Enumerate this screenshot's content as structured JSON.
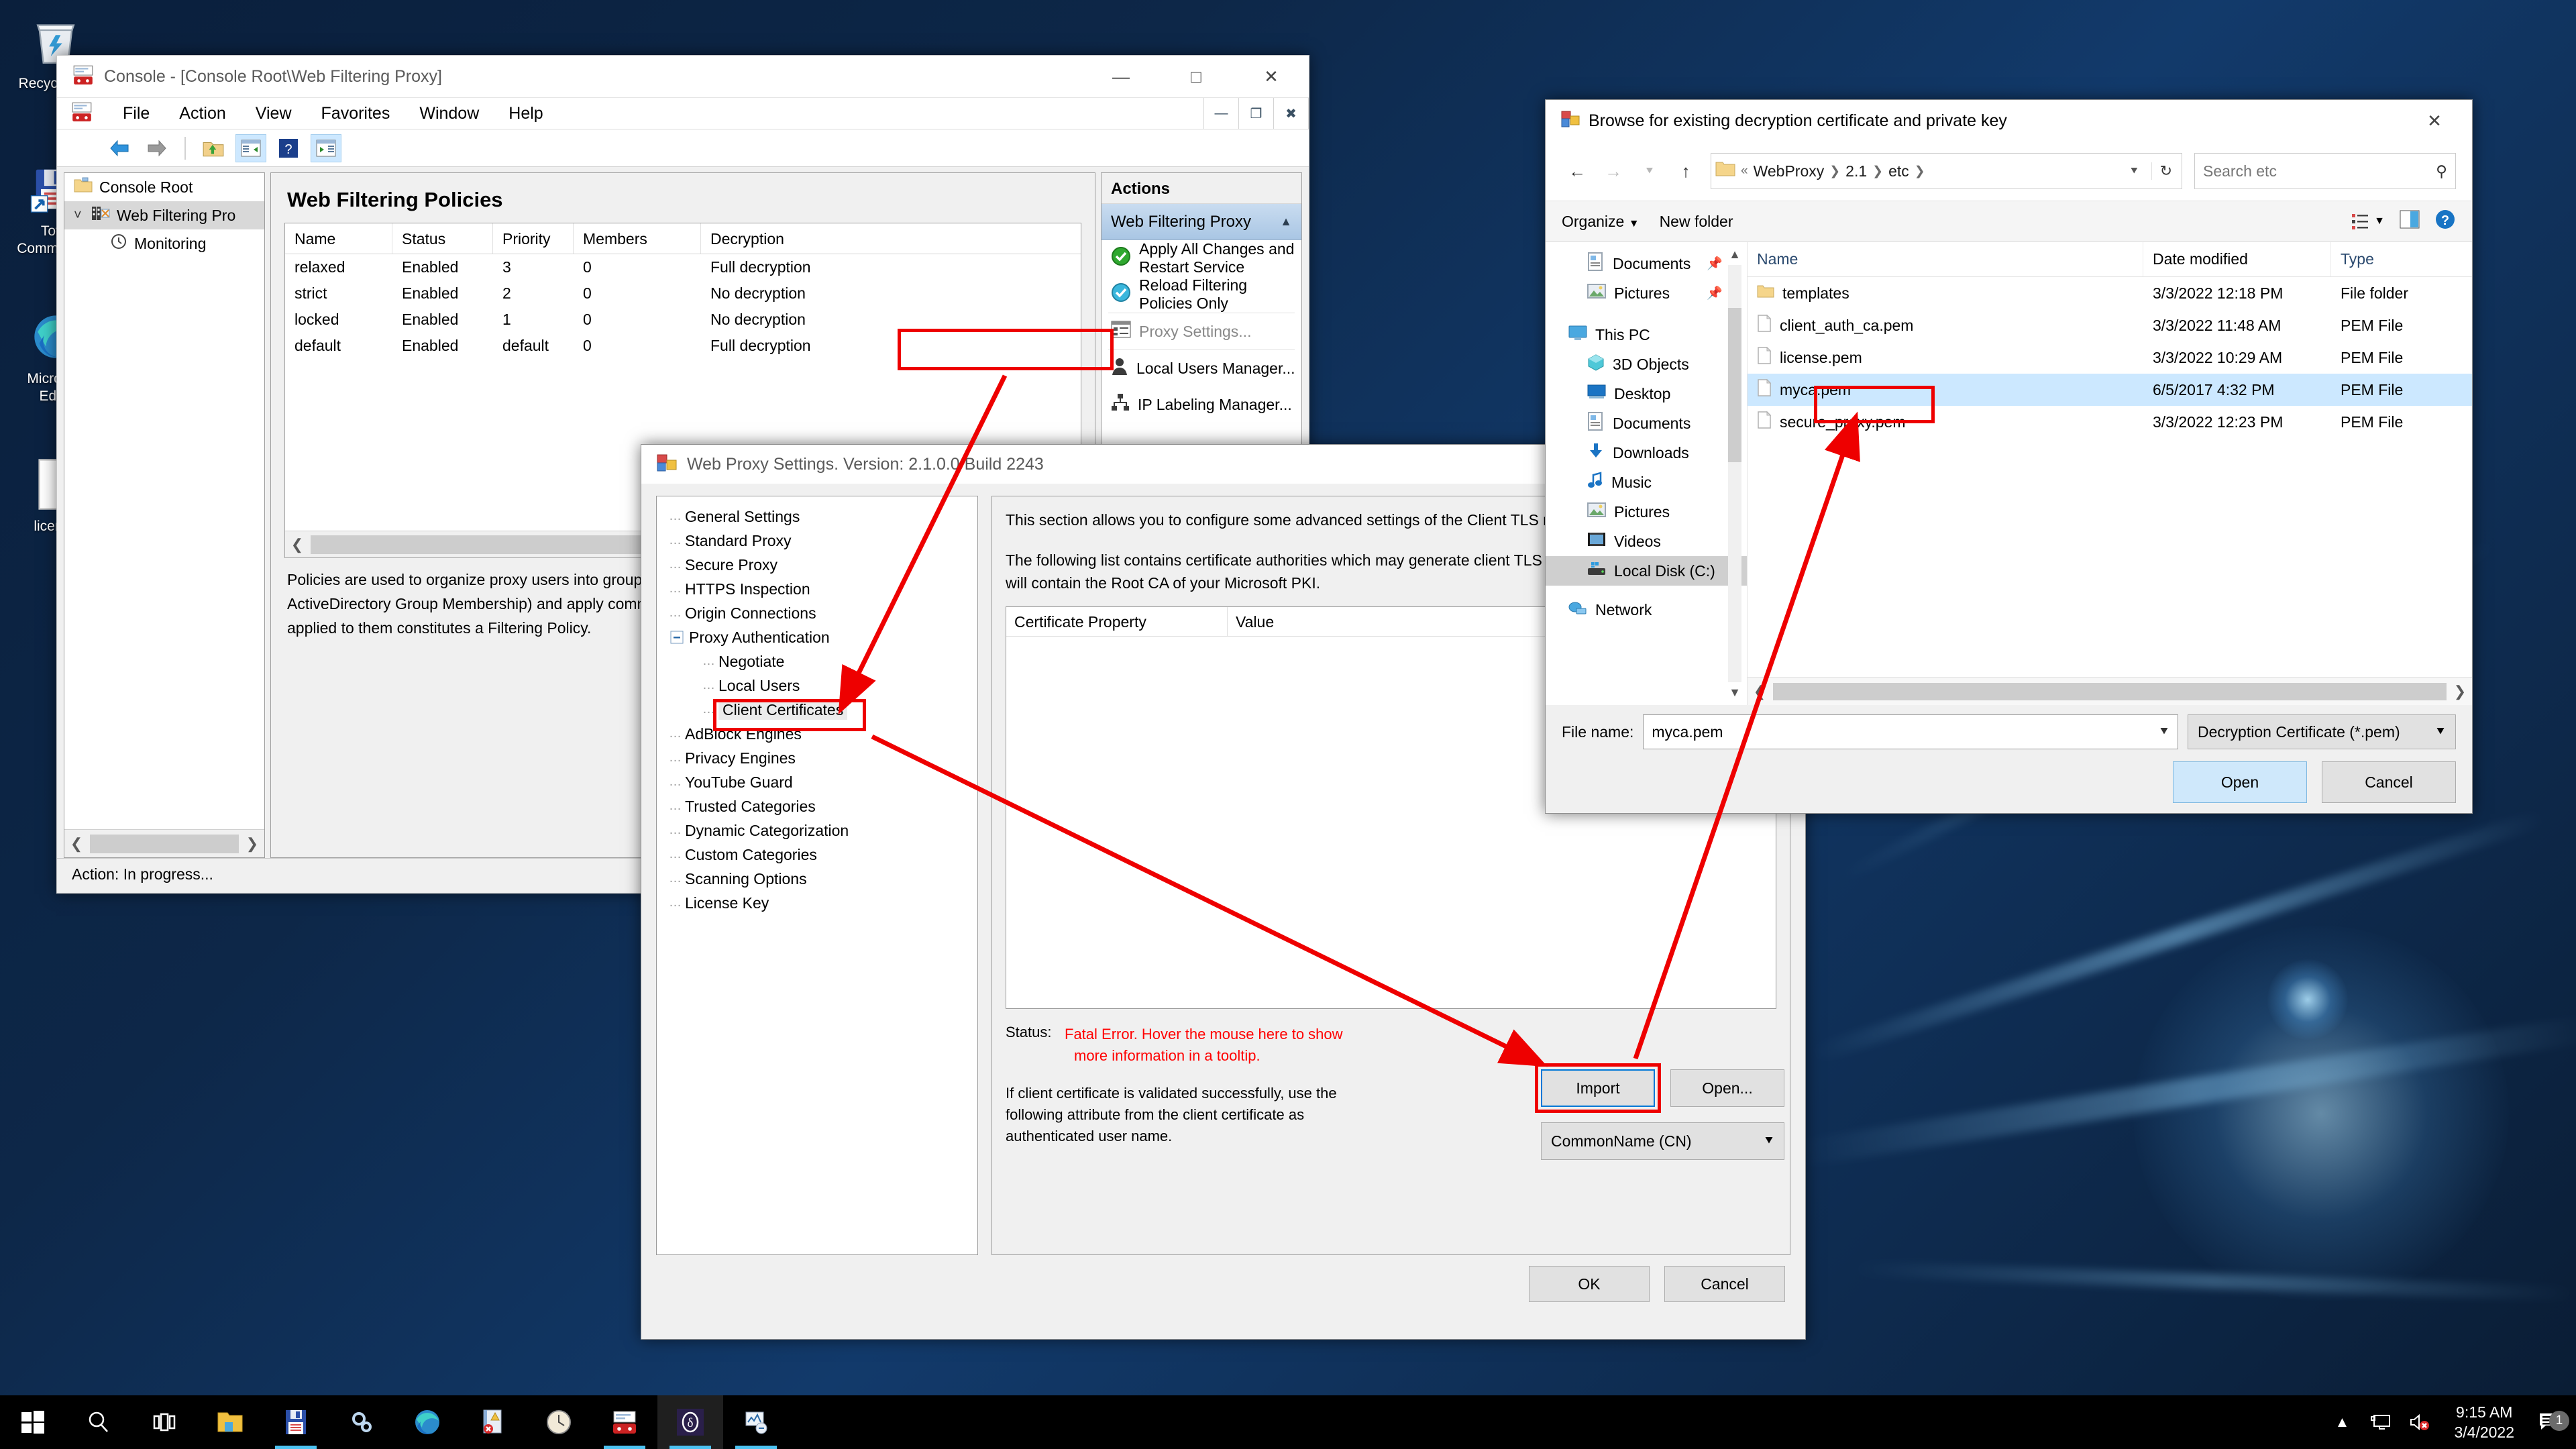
{
  "desktop": {
    "icons": [
      {
        "name": "recycle-bin",
        "label": "Recycle Bin"
      },
      {
        "name": "total-commander",
        "label": "Total\nCommander"
      },
      {
        "name": "microsoft-edge",
        "label": "Microsoft\nEdge"
      },
      {
        "name": "license-file",
        "label": "license"
      }
    ]
  },
  "taskbar": {
    "items": [
      {
        "name": "start-button",
        "icon": "windows-logo-icon"
      },
      {
        "name": "search-button",
        "icon": "search-icon"
      },
      {
        "name": "task-view-button",
        "icon": "task-view-icon"
      },
      {
        "name": "file-explorer-button",
        "icon": "folder-icon"
      },
      {
        "name": "total-commander-button",
        "icon": "floppy-disk-icon"
      },
      {
        "name": "settings-button",
        "icon": "gears-icon"
      },
      {
        "name": "microsoft-edge-button",
        "icon": "edge-icon"
      },
      {
        "name": "event-viewer-button",
        "icon": "event-log-icon"
      },
      {
        "name": "clock-app-button",
        "icon": "clock-icon"
      },
      {
        "name": "mmc-console-button",
        "icon": "mmc-icon"
      },
      {
        "name": "delta-app-button",
        "icon": "delta-icon"
      },
      {
        "name": "monitor-app-button",
        "icon": "perfmon-icon"
      }
    ],
    "tray": {
      "show_hidden_icons": "show-hidden-icons-icon",
      "network": "network-icon",
      "volume": "volume-muted-icon",
      "time": "9:15 AM",
      "date": "3/4/2022",
      "notifications_count": "1"
    }
  },
  "mmc": {
    "title": "Console - [Console Root\\Web Filtering Proxy]",
    "menu": [
      "File",
      "Action",
      "View",
      "Favorites",
      "Window",
      "Help"
    ],
    "tree": [
      {
        "label": "Console Root",
        "level": 0,
        "icon": "folder-icon",
        "selected": false
      },
      {
        "label": "Web Filtering Pro",
        "level": 1,
        "icon": "proxy-icon",
        "selected": true
      },
      {
        "label": "Monitoring",
        "level": 2,
        "icon": "clock-icon",
        "selected": false
      }
    ],
    "page_title": "Web Filtering Policies",
    "policies": {
      "columns": [
        "Name",
        "Status",
        "Priority",
        "Members",
        "Decryption"
      ],
      "rows": [
        {
          "name": "relaxed",
          "status": "Enabled",
          "priority": "3",
          "members": "0",
          "decryption": "Full decryption"
        },
        {
          "name": "strict",
          "status": "Enabled",
          "priority": "2",
          "members": "0",
          "decryption": "No decryption"
        },
        {
          "name": "locked",
          "status": "Enabled",
          "priority": "1",
          "members": "0",
          "decryption": "No decryption"
        },
        {
          "name": "default",
          "status": "Enabled",
          "priority": "default",
          "members": "0",
          "decryption": "Full decryption"
        }
      ]
    },
    "description": "Policies are used to organize proxy users into groups (by IP Address, Range or Subnet and LDAP or ActiveDirectory Group Membership) and apply common filtering settings to them. Filtering rules and exclusions applied to them constitutes a Filtering Policy.",
    "status": "Action:  In progress...",
    "actions": {
      "header": "Actions",
      "section": "Web Filtering Proxy",
      "items": [
        {
          "label": "Apply All Changes and Restart Service",
          "icon": "green-check-icon",
          "dim": false
        },
        {
          "label": "Reload Filtering Policies Only",
          "icon": "blue-check-icon",
          "dim": false
        },
        {
          "label": "Proxy Settings...",
          "icon": "settings-list-icon",
          "dim": true,
          "highlighted": true
        },
        {
          "label": "Local Users Manager...",
          "icon": "user-icon",
          "dim": false
        },
        {
          "label": "IP Labeling Manager...",
          "icon": "network-tree-icon",
          "dim": false
        }
      ]
    }
  },
  "proxy_settings": {
    "title": "Web Proxy Settings. Version: 2.1.0.0 Build 2243",
    "tree": [
      {
        "label": "General Settings",
        "level": 1
      },
      {
        "label": "Standard Proxy",
        "level": 1
      },
      {
        "label": "Secure Proxy",
        "level": 1
      },
      {
        "label": "HTTPS Inspection",
        "level": 1
      },
      {
        "label": "Origin Connections",
        "level": 1
      },
      {
        "label": "Proxy Authentication",
        "level": 1,
        "expander": "minus"
      },
      {
        "label": "Negotiate",
        "level": 2
      },
      {
        "label": "Local Users",
        "level": 2
      },
      {
        "label": "Client Certificates",
        "level": 2,
        "selected": true,
        "highlighted": true
      },
      {
        "label": "AdBlock Engines",
        "level": 1
      },
      {
        "label": "Privacy Engines",
        "level": 1
      },
      {
        "label": "YouTube Guard",
        "level": 1
      },
      {
        "label": "Trusted Categories",
        "level": 1
      },
      {
        "label": "Dynamic Categorization",
        "level": 1
      },
      {
        "label": "Custom Categories",
        "level": 1
      },
      {
        "label": "Scanning Options",
        "level": 1
      },
      {
        "label": "License Key",
        "level": 1
      }
    ],
    "intro_paragraph_1": "This section allows you to configure some advanced settings of the Client TLS module.",
    "intro_paragraph_2": "The following list contains certificate authorities which may generate client TLS authentication. Usually this list will contain the Root CA of your Microsoft PKI.",
    "cert_table": {
      "columns": [
        "Certificate Property",
        "Value"
      ],
      "rows": []
    },
    "status_label": "Status:",
    "status_value_line1": "Fatal Error. Hover the mouse here to show",
    "status_value_line2": "more information in a tooltip.",
    "attribute_text": "If client certificate is validated successfully, use the following attribute from the client certificate as authenticated user name.",
    "import_button": "Import",
    "open_button": "Open...",
    "attribute_combo": "CommonName (CN)",
    "ok_button": "OK",
    "cancel_button": "Cancel",
    "status_color": "#ff0000"
  },
  "file_dialog": {
    "title": "Browse for existing decryption certificate and private key",
    "breadcrumb": [
      "WebProxy",
      "2.1",
      "etc"
    ],
    "search_placeholder": "Search etc",
    "toolbar": {
      "organize": "Organize",
      "new_folder": "New folder"
    },
    "nav_pane": [
      {
        "label": "Documents",
        "icon": "documents-icon",
        "level": 1,
        "pinned": true
      },
      {
        "label": "Pictures",
        "icon": "pictures-icon",
        "level": 1,
        "pinned": true
      },
      {
        "label": "This PC",
        "icon": "this-pc-icon",
        "level": 0
      },
      {
        "label": "3D Objects",
        "icon": "3d-objects-icon",
        "level": 1
      },
      {
        "label": "Desktop",
        "icon": "desktop-icon",
        "level": 1
      },
      {
        "label": "Documents",
        "icon": "documents-icon",
        "level": 1
      },
      {
        "label": "Downloads",
        "icon": "downloads-icon",
        "level": 1
      },
      {
        "label": "Music",
        "icon": "music-icon",
        "level": 1
      },
      {
        "label": "Pictures",
        "icon": "pictures-icon",
        "level": 1
      },
      {
        "label": "Videos",
        "icon": "videos-icon",
        "level": 1
      },
      {
        "label": "Local Disk (C:)",
        "icon": "disk-icon",
        "level": 1,
        "selected": true
      },
      {
        "label": "Network",
        "icon": "network-icon",
        "level": 0
      }
    ],
    "columns": [
      "Name",
      "Date modified",
      "Type"
    ],
    "files": [
      {
        "name": "templates",
        "date": "3/3/2022 12:18 PM",
        "type": "File folder",
        "icon": "folder-icon",
        "selected": false
      },
      {
        "name": "client_auth_ca.pem",
        "date": "3/3/2022 11:48 AM",
        "type": "PEM File",
        "icon": "file-icon",
        "selected": false
      },
      {
        "name": "license.pem",
        "date": "3/3/2022 10:29 AM",
        "type": "PEM File",
        "icon": "file-icon",
        "selected": false
      },
      {
        "name": "myca.pem",
        "date": "6/5/2017 4:32 PM",
        "type": "PEM File",
        "icon": "file-icon",
        "selected": true,
        "highlighted": true
      },
      {
        "name": "secure_proxy.pem",
        "date": "3/3/2022 12:23 PM",
        "type": "PEM File",
        "icon": "file-icon",
        "selected": false
      }
    ],
    "file_name_label": "File name:",
    "file_name_value": "myca.pem",
    "filter_value": "Decryption Certificate (*.pem)",
    "open_button": "Open",
    "cancel_button": "Cancel"
  },
  "annotation_color": "#ee0000"
}
